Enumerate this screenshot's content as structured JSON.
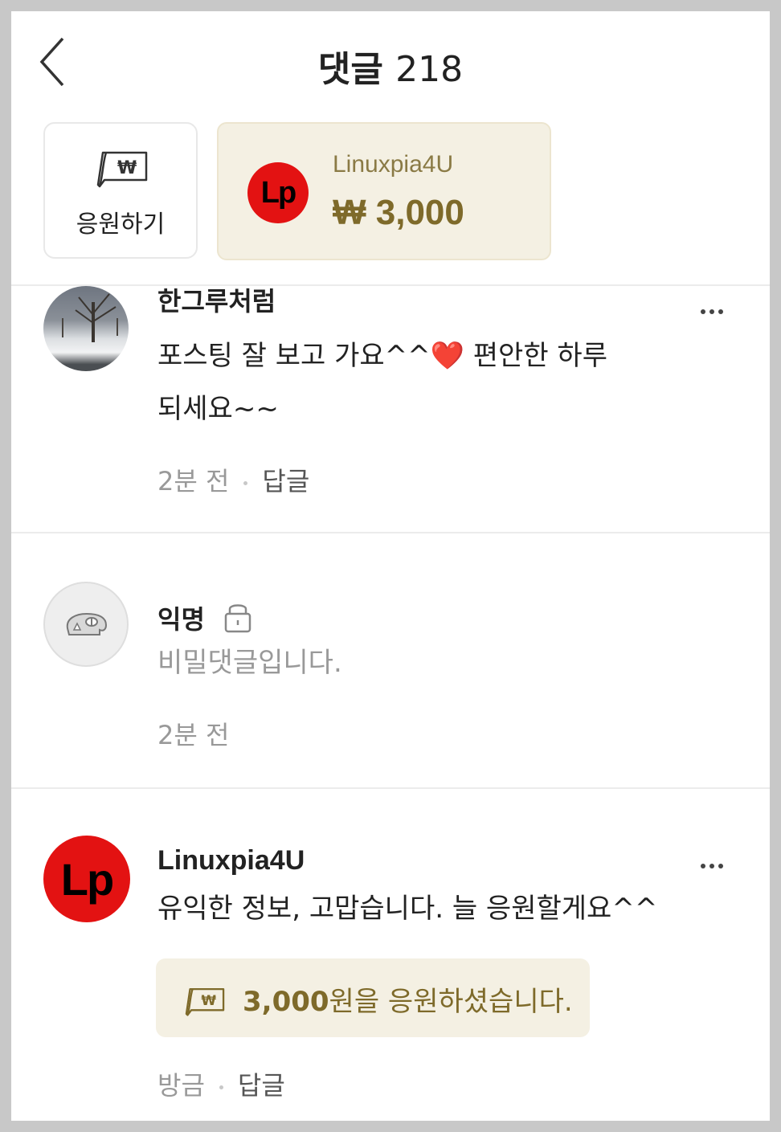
{
  "header": {
    "title": "댓글",
    "count": "218"
  },
  "support": {
    "button_label": "응원하기",
    "top_supporter": {
      "avatar_text": "Lp",
      "name": "Linuxpia4U",
      "amount": "₩ 3,000"
    }
  },
  "comments": [
    {
      "name": "한그루처럼",
      "text_line1": "포스팅 잘 보고 가요^^❤️ 편안한 하루",
      "text_line2": "되세요~~",
      "time": "2분 전",
      "reply_label": "답글",
      "avatar": "winter-tree-photo"
    },
    {
      "name": "익명",
      "text": "비밀댓글입니다.",
      "time": "2분 전",
      "avatar": "anonymous-icon"
    },
    {
      "name": "Linuxpia4U",
      "avatar_text": "Lp",
      "text": "유익한 정보, 고맙습니다. 늘 응원할게요^^",
      "donation_amount": "3,000",
      "donation_suffix": "원을 응원하셨습니다.",
      "time": "방금",
      "reply_label": "답글"
    }
  ],
  "colors": {
    "gold_bg": "#f4f0e3",
    "gold_text": "#7e6a2a",
    "lp_red": "#e31212"
  }
}
